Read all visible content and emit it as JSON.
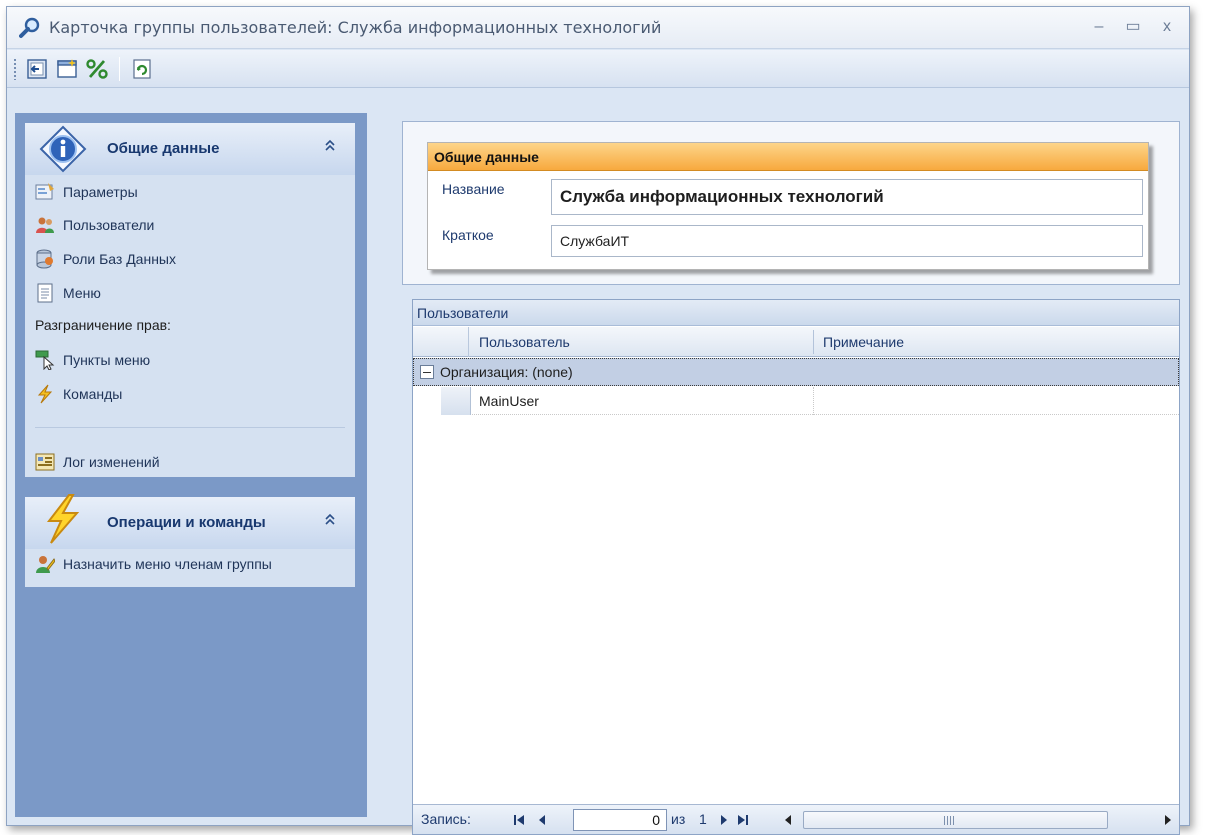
{
  "window": {
    "title": "Карточка группы пользователей: Служба информационных технологий",
    "minimize": "–",
    "maximize": "▭",
    "close": "x"
  },
  "toolbar": {
    "buttons": [
      "save-and-close-icon",
      "new-icon",
      "percent-icon",
      "refresh-icon"
    ]
  },
  "nav": {
    "group1": {
      "title": "Общие данные",
      "items": [
        {
          "label": "Параметры",
          "icon": "parameters-icon"
        },
        {
          "label": "Пользователи",
          "icon": "users-icon"
        },
        {
          "label": "Роли Баз Данных",
          "icon": "db-roles-icon"
        },
        {
          "label": "Меню",
          "icon": "menu-doc-icon"
        }
      ],
      "section": "Разграничение прав:",
      "rights": [
        {
          "label": "Пункты меню",
          "icon": "menu-items-icon"
        },
        {
          "label": "Команды",
          "icon": "lightning-icon"
        }
      ],
      "log": "Лог изменений"
    },
    "group2": {
      "title": "Операции и команды",
      "items": [
        {
          "label": "Назначить меню членам группы",
          "icon": "assign-menu-icon"
        }
      ]
    },
    "collapse_glyph": "⌃"
  },
  "card": {
    "header": "Общие данные",
    "name_label": "Название",
    "name_value": "Служба информационных технологий",
    "short_label": "Краткое",
    "short_value": "СлужбаИТ"
  },
  "grid": {
    "caption": "Пользователи",
    "columns": [
      "Пользователь",
      "Примечание"
    ],
    "group_row": "Организация:  (none)",
    "rows": [
      {
        "user": "MainUser",
        "note": ""
      }
    ]
  },
  "navigator": {
    "record_label": "Запись:",
    "current": "0",
    "of": "из",
    "total": "1"
  },
  "colors": {
    "nav_bg": "#7b99c7",
    "card_header": "#f7a93e",
    "window_bg": "#dbe6f4"
  }
}
